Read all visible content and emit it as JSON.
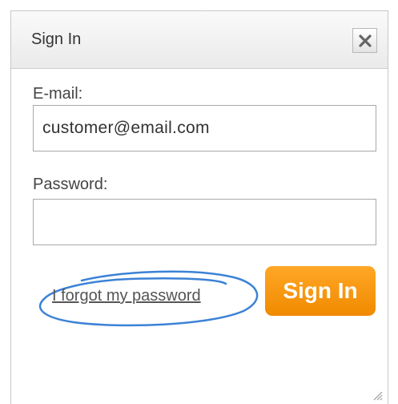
{
  "dialog": {
    "title": "Sign In",
    "close_icon": "close-x-icon"
  },
  "form": {
    "email_label": "E-mail:",
    "email_value": "customer@email.com",
    "password_label": "Password:",
    "password_value": ""
  },
  "actions": {
    "forgot_link": "I forgot my password",
    "signin_label": "Sign In"
  },
  "colors": {
    "accent": "#f7941d",
    "highlight_oval": "#3b82d6"
  },
  "icons": {
    "resize": "resize-grip-icon"
  }
}
